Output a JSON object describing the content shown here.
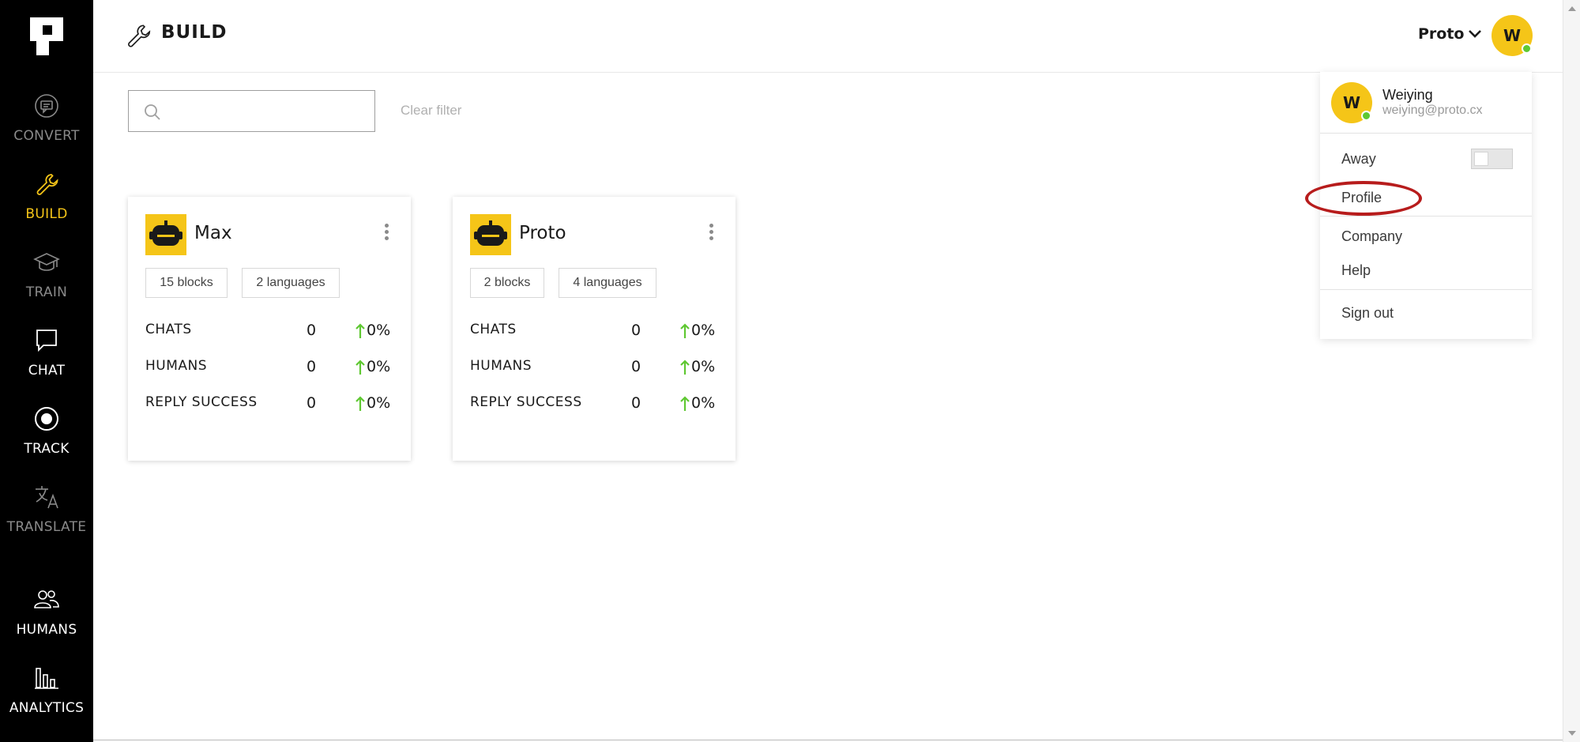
{
  "sidebar": {
    "items": [
      {
        "label": "CONVERT",
        "icon": "convert-icon"
      },
      {
        "label": "BUILD",
        "icon": "wrench-icon"
      },
      {
        "label": "TRAIN",
        "icon": "graduation-cap-icon"
      },
      {
        "label": "CHAT",
        "icon": "chat-bubble-icon"
      },
      {
        "label": "TRACK",
        "icon": "target-icon"
      },
      {
        "label": "TRANSLATE",
        "icon": "translate-icon"
      },
      {
        "label": "HUMANS",
        "icon": "people-icon"
      },
      {
        "label": "ANALYTICS",
        "icon": "bar-chart-icon"
      }
    ]
  },
  "header": {
    "title": "BUILD",
    "org_name": "Proto",
    "avatar_initial": "W"
  },
  "search": {
    "placeholder": "",
    "value": "",
    "clear_label": "Clear filter"
  },
  "bots": [
    {
      "name": "Max",
      "blocks": "15 blocks",
      "languages": "2 languages",
      "stats": [
        {
          "label": "CHATS",
          "value": "0",
          "change": "0%"
        },
        {
          "label": "HUMANS",
          "value": "0",
          "change": "0%"
        },
        {
          "label": "REPLY SUCCESS",
          "value": "0",
          "change": "0%"
        }
      ]
    },
    {
      "name": "Proto",
      "blocks": "2 blocks",
      "languages": "4 languages",
      "stats": [
        {
          "label": "CHATS",
          "value": "0",
          "change": "0%"
        },
        {
          "label": "HUMANS",
          "value": "0",
          "change": "0%"
        },
        {
          "label": "REPLY SUCCESS",
          "value": "0",
          "change": "0%"
        }
      ]
    }
  ],
  "user_menu": {
    "initial": "W",
    "name": "Weiying",
    "email": "weiying@proto.cx",
    "away_label": "Away",
    "away_on": false,
    "items": [
      "Profile",
      "Company",
      "Help",
      "Sign out"
    ]
  },
  "colors": {
    "accent": "#f5c518",
    "sidebar_bg": "#000000",
    "online": "#5fc832",
    "up_arrow": "#5fc832",
    "highlight": "#b71c1c"
  }
}
